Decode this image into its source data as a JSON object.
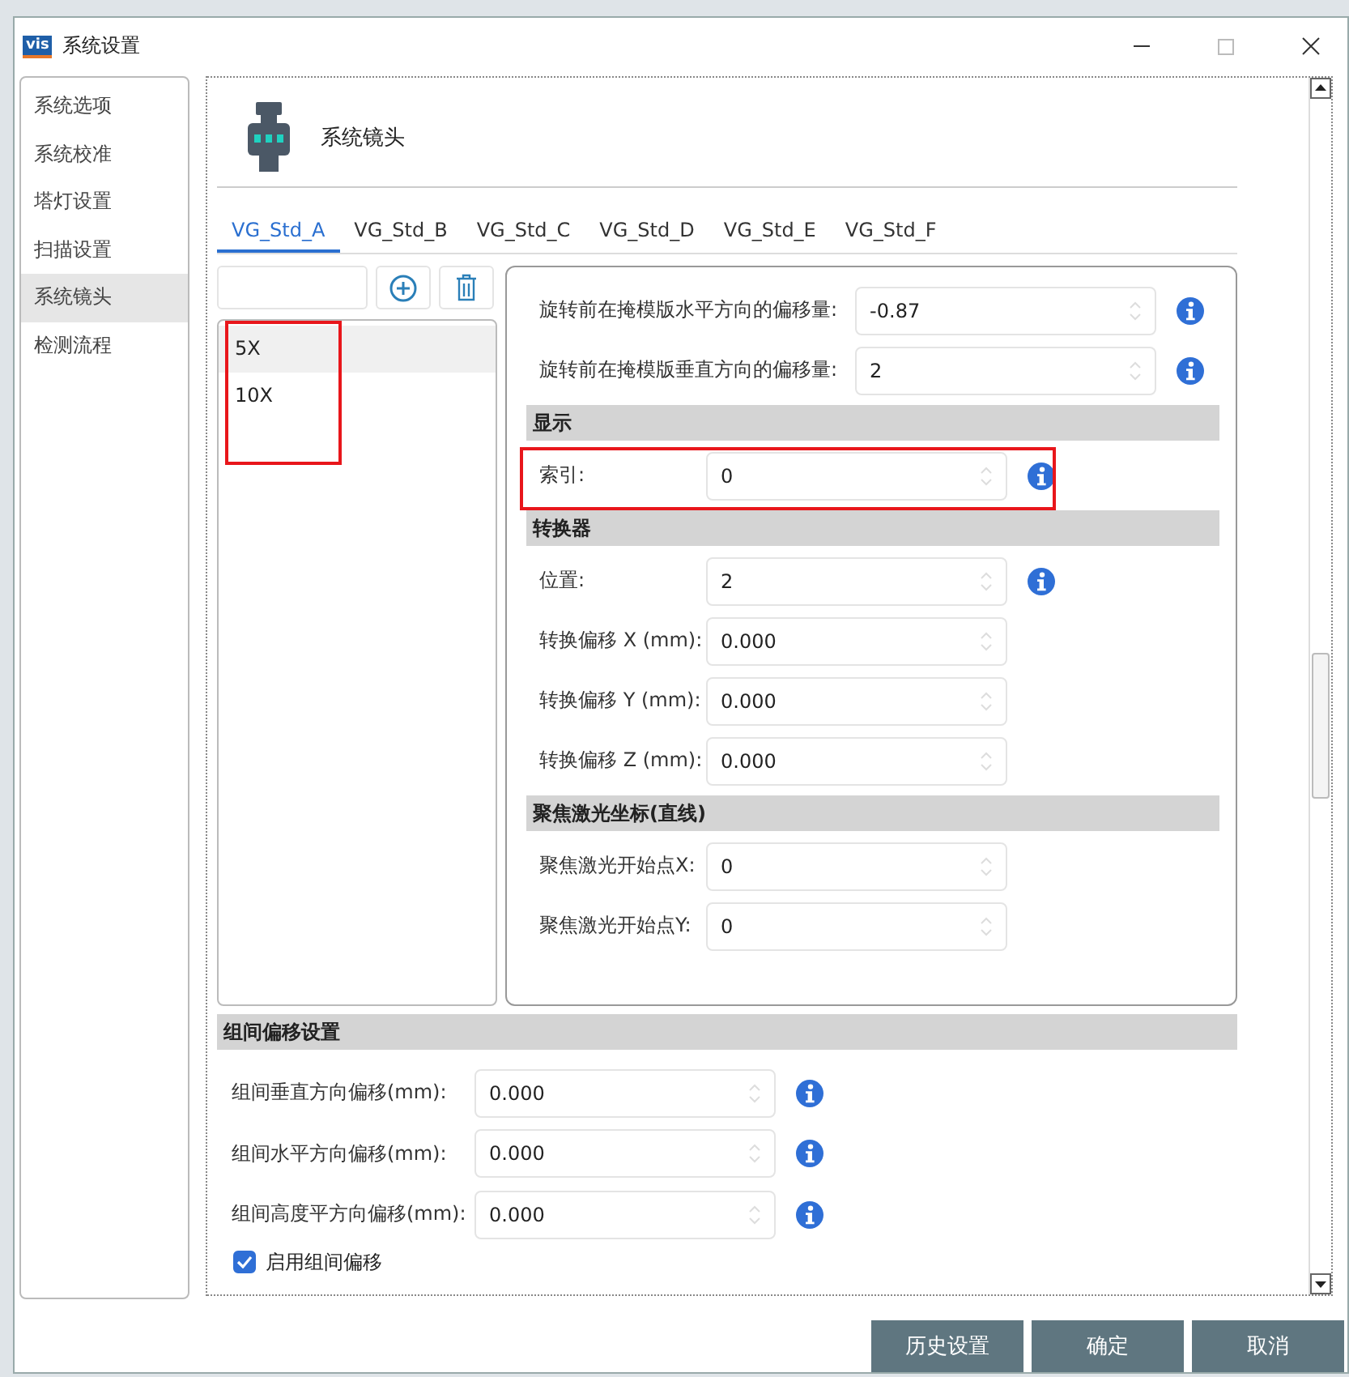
{
  "window": {
    "logo": "vis",
    "title": "系统设置"
  },
  "sidebar": {
    "items": [
      {
        "label": "系统选项",
        "selected": false
      },
      {
        "label": "系统校准",
        "selected": false
      },
      {
        "label": "塔灯设置",
        "selected": false
      },
      {
        "label": "扫描设置",
        "selected": false
      },
      {
        "label": "系统镜头",
        "selected": true
      },
      {
        "label": "检测流程",
        "selected": false
      }
    ]
  },
  "section_title": "系统镜头",
  "tabs": [
    {
      "label": "VG_Std_A",
      "selected": true
    },
    {
      "label": "VG_Std_B",
      "selected": false
    },
    {
      "label": "VG_Std_C",
      "selected": false
    },
    {
      "label": "VG_Std_D",
      "selected": false
    },
    {
      "label": "VG_Std_E",
      "selected": false
    },
    {
      "label": "VG_Std_F",
      "selected": false
    }
  ],
  "lens_list": {
    "highlighted": true,
    "items": [
      {
        "label": "5X",
        "selected": true
      },
      {
        "label": "10X",
        "selected": false
      }
    ]
  },
  "properties": [
    {
      "kind": "field",
      "label": "旋转前在掩模版水平方向的偏移量:",
      "value": "-0.87",
      "info": true,
      "highlighted": false
    },
    {
      "kind": "field",
      "label": "旋转前在掩模版垂直方向的偏移量:",
      "value": "2",
      "info": true,
      "highlighted": false
    },
    {
      "kind": "header",
      "label": "显示"
    },
    {
      "kind": "field",
      "label": "索引:",
      "value": "0",
      "info": true,
      "highlighted": true
    },
    {
      "kind": "header",
      "label": "转换器"
    },
    {
      "kind": "field",
      "label": "位置:",
      "value": "2",
      "info": true,
      "highlighted": false
    },
    {
      "kind": "field",
      "label": "转换偏移 X (mm):",
      "value": "0.000",
      "info": false,
      "highlighted": false
    },
    {
      "kind": "field",
      "label": "转换偏移 Y (mm):",
      "value": "0.000",
      "info": false,
      "highlighted": false
    },
    {
      "kind": "field",
      "label": "转换偏移 Z (mm):",
      "value": "0.000",
      "info": false,
      "highlighted": false
    },
    {
      "kind": "header",
      "label": "聚焦激光坐标(直线)"
    },
    {
      "kind": "field",
      "label": "聚焦激光开始点X:",
      "value": "0",
      "info": false,
      "highlighted": false
    },
    {
      "kind": "field",
      "label": "聚焦激光开始点Y:",
      "value": "0",
      "info": false,
      "highlighted": false
    }
  ],
  "group_offset": {
    "title": "组间偏移设置",
    "rows": [
      {
        "label": "组间垂直方向偏移(mm):",
        "value": "0.000",
        "info": true
      },
      {
        "label": "组间水平方向偏移(mm):",
        "value": "0.000",
        "info": true
      },
      {
        "label": "组间高度平方向偏移(mm):",
        "value": "0.000",
        "info": true
      }
    ],
    "enable": {
      "label": "启用组间偏移",
      "checked": true
    }
  },
  "buttons": [
    "历史设置",
    "确定",
    "取消"
  ]
}
